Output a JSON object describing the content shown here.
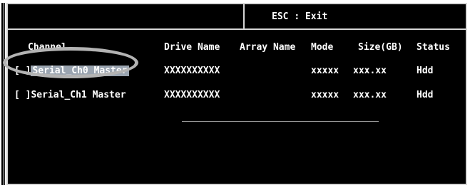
{
  "hint": {
    "key": "ESC",
    "sep": ":",
    "action": "Exit"
  },
  "columns": [
    "Channel",
    "Drive Name",
    "Array Name",
    "Mode",
    "Size(GB)",
    "Status"
  ],
  "rows": [
    {
      "check": "[ ]",
      "channel": "Serial_Ch0 Master",
      "drive": "XXXXXXXXXX",
      "array": "",
      "mode": "xxxxx",
      "size": "xxx.xx",
      "status": "Hdd",
      "selected": true
    },
    {
      "check": "[ ]",
      "channel": "Serial_Ch1 Master",
      "drive": "XXXXXXXXXX",
      "array": "",
      "mode": "xxxxx",
      "size": "xxx.xx",
      "status": "Hdd",
      "selected": false
    }
  ],
  "colors": {
    "background": "#000000",
    "text": "#ffffff",
    "highlight": "#9aa4b0",
    "annotation_circle": "#b3b3b3"
  }
}
